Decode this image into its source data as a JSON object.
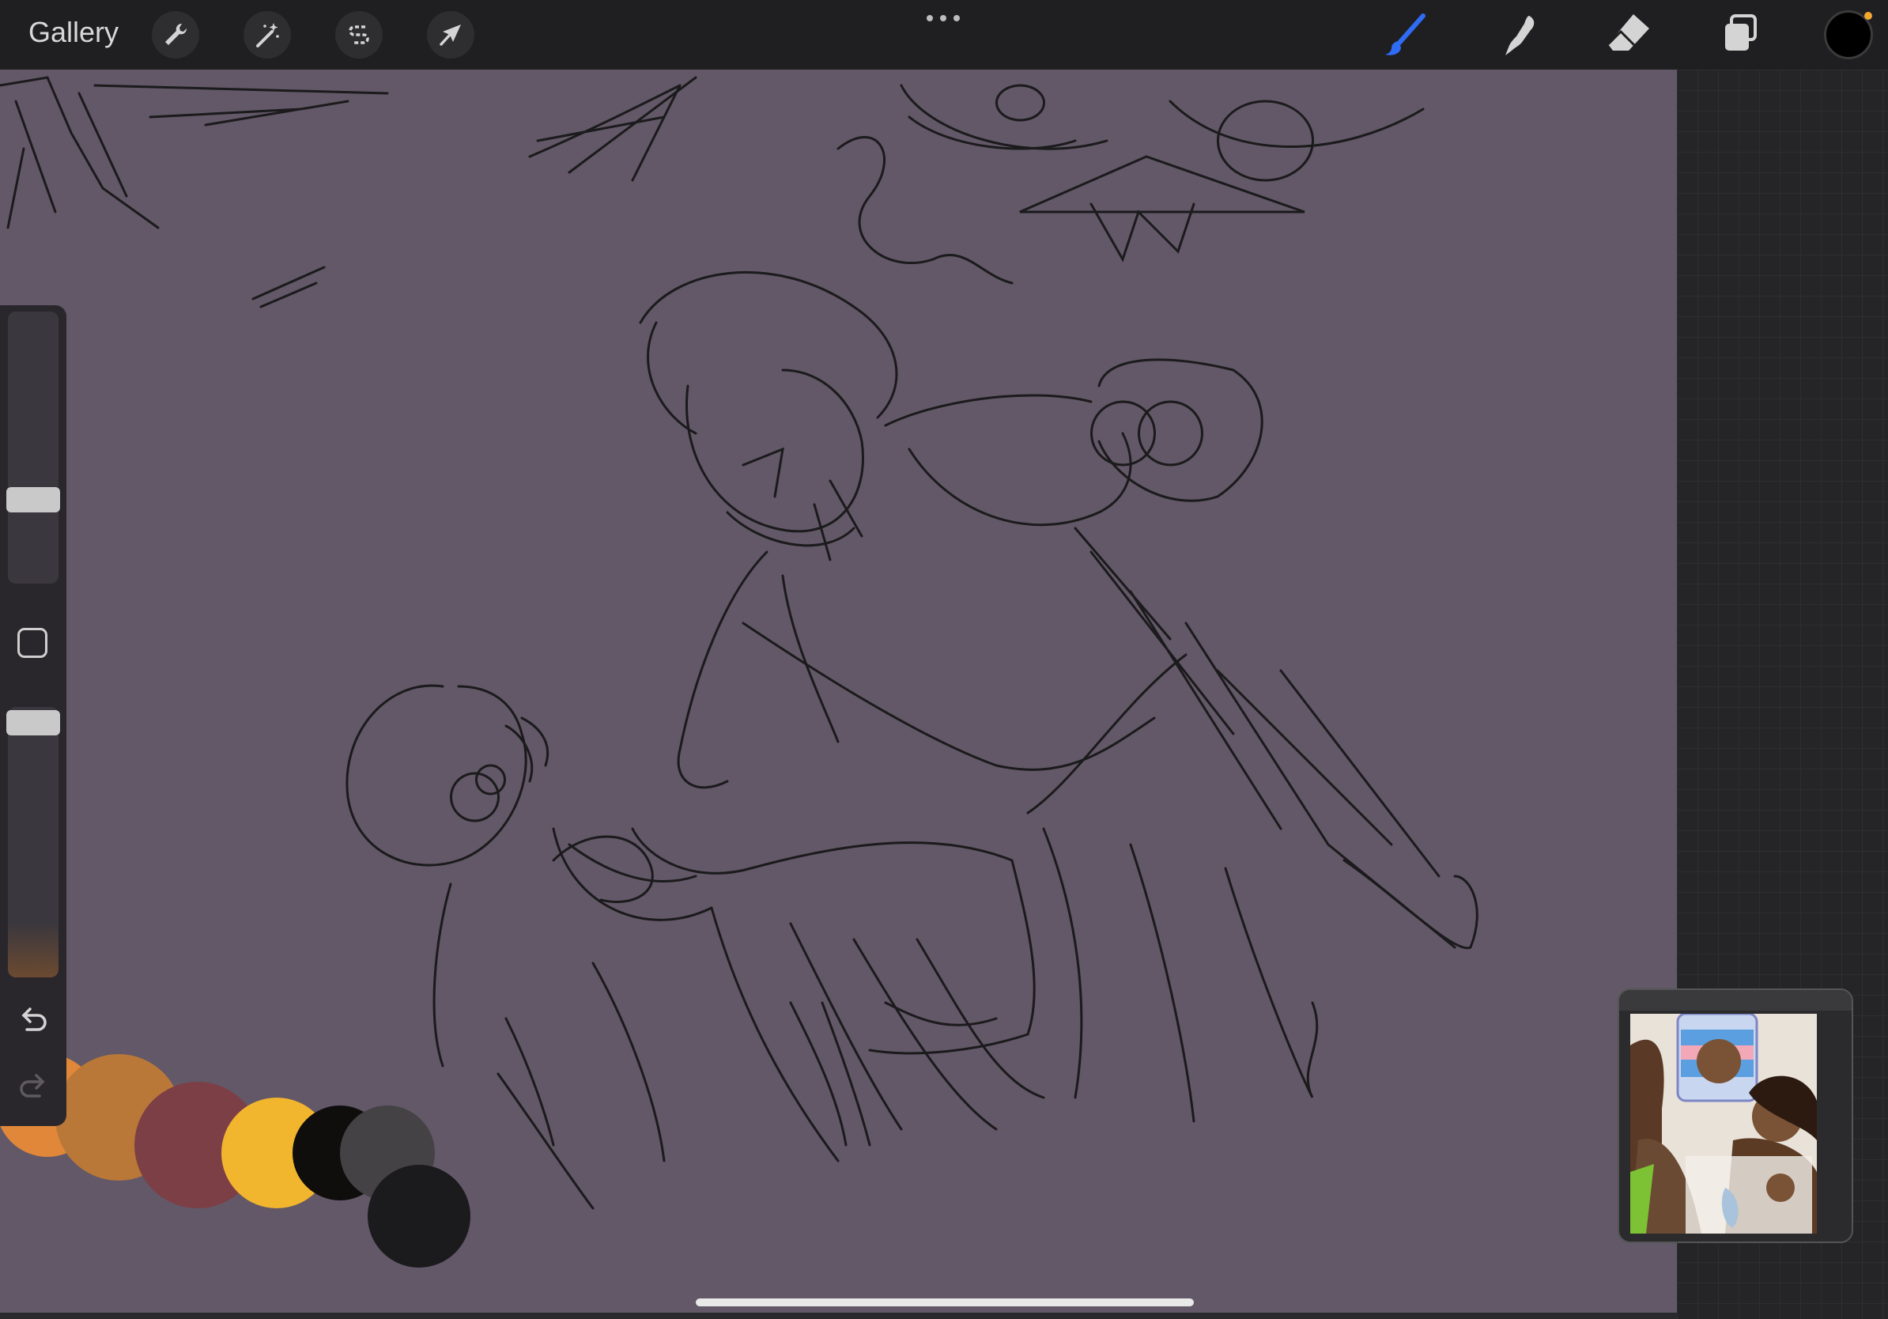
{
  "topbar": {
    "gallery_label": "Gallery",
    "left_tools": [
      {
        "name": "actions",
        "icon": "wrench-icon"
      },
      {
        "name": "adjustments",
        "icon": "magic-wand-icon"
      },
      {
        "name": "selection",
        "icon": "selection-s-icon"
      },
      {
        "name": "transform",
        "icon": "arrow-cursor-icon"
      }
    ],
    "more_icon": "more-dots-icon",
    "right_tools": [
      {
        "name": "brush",
        "icon": "brush-icon",
        "active": true
      },
      {
        "name": "smudge",
        "icon": "smudge-icon"
      },
      {
        "name": "eraser",
        "icon": "eraser-icon"
      },
      {
        "name": "layers",
        "icon": "layers-icon"
      }
    ],
    "current_color": "#000000"
  },
  "sidebar": {
    "brush_size_level": 0.64,
    "opacity_level": 0.94,
    "undo_icon": "undo-icon",
    "redo_icon": "redo-icon"
  },
  "palette_swatches": [
    "#e0873a",
    "#b97838",
    "#7d3f46",
    "#f2b52e",
    "#0f0e0d",
    "#454246",
    "#1b1a1c"
  ],
  "colors": {
    "canvas_bg": "#625867",
    "accent": "#2f6cf6",
    "sketch": "#111111"
  }
}
